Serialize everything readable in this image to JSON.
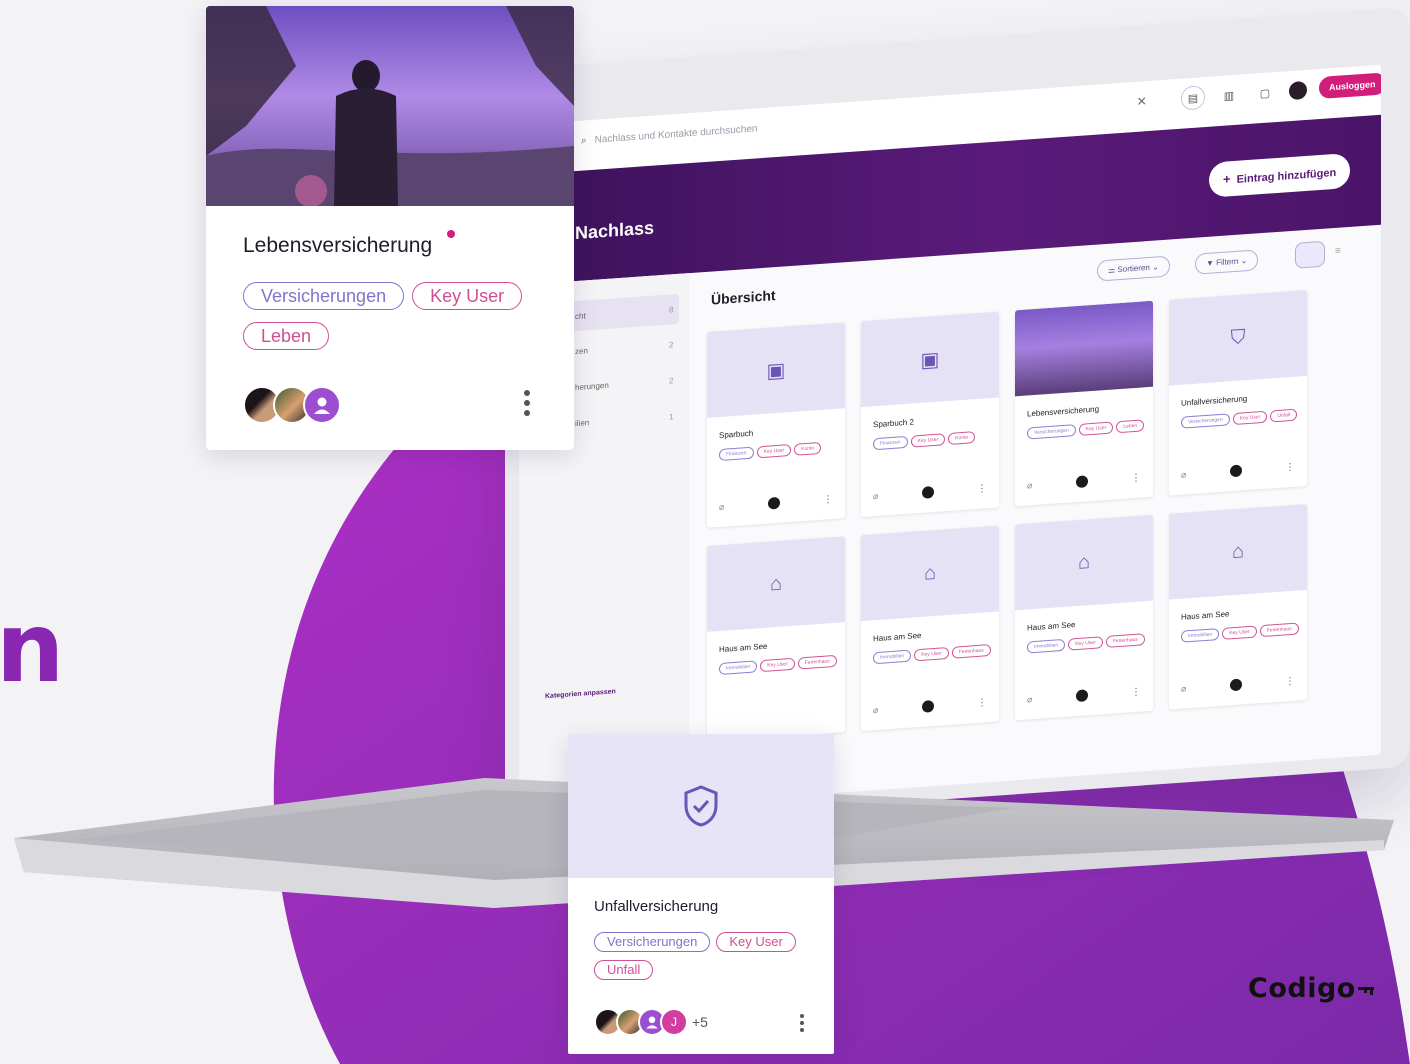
{
  "colors": {
    "accent": "#8a27b2",
    "brand_dark": "#5a1b7a",
    "logout": "#d21d7a",
    "tag_blue": "#8074cc",
    "tag_pink": "#cf4f95"
  },
  "partial_heading": "n",
  "brand": {
    "name": "Codigo"
  },
  "app": {
    "search_placeholder": "Nachlass und Kontakte durchsuchen",
    "close_label": "×",
    "logout_label": "Ausloggen",
    "hero_title": "Nachlass",
    "add_entry_label": "Eintrag hinzufügen",
    "main_title": "Übersicht",
    "sort_label": "Sortieren",
    "filter_label": "Filtern",
    "sidebar": {
      "items": [
        {
          "label": "cht",
          "count": "8"
        },
        {
          "label": "zen",
          "count": "2"
        },
        {
          "label": "herungen",
          "count": "2"
        },
        {
          "label": "ilien",
          "count": "1"
        }
      ],
      "category_link": "Kategorien anpassen"
    },
    "cards": [
      {
        "title": "Sparbuch",
        "icon": "wallet-icon",
        "tags": [
          "Finanzen",
          "Key User",
          "Konto"
        ]
      },
      {
        "title": "Sparbuch 2",
        "icon": "wallet-icon",
        "tags": [
          "Finanzen",
          "Key User",
          "Konto"
        ]
      },
      {
        "title": "Lebensversicherung",
        "icon": "photo",
        "tags": [
          "Versicherungen",
          "Key User",
          "Leben"
        ]
      },
      {
        "title": "Unfallversicherung",
        "icon": "shield-check-icon",
        "tags": [
          "Versicherungen",
          "Key User",
          "Unfall"
        ]
      },
      {
        "title": "Haus am See",
        "icon": "home-icon",
        "tags": [
          "Immobilien",
          "Key User",
          "Ferienhaus"
        ]
      },
      {
        "title": "Haus am See",
        "icon": "home-icon",
        "tags": [
          "Immobilien",
          "Key User",
          "Ferienhaus"
        ]
      },
      {
        "title": "Haus am See",
        "icon": "home-icon",
        "tags": [
          "Immobilien",
          "Key User",
          "Ferienhaus"
        ]
      },
      {
        "title": "Haus am See",
        "icon": "home-icon",
        "tags": [
          "Immobilien",
          "Key User",
          "Ferienhaus"
        ]
      }
    ]
  },
  "card_life": {
    "title": "Lebensversicherung",
    "tags": [
      "Versicherungen",
      "Key User",
      "Leben"
    ]
  },
  "card_accident": {
    "title": "Unfallversicherung",
    "tags": [
      "Versicherungen",
      "Key User",
      "Unfall"
    ],
    "avatar_initial": "J",
    "more_count": "+5"
  }
}
